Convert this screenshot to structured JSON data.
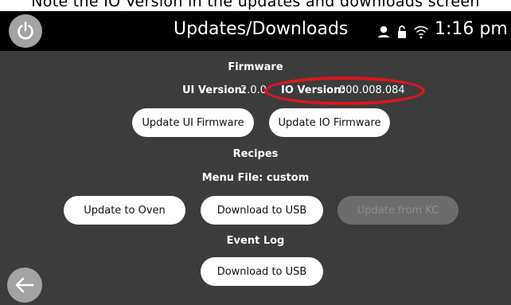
{
  "top_strip": {
    "text": "Note the IO Version in the updates and downloads screen"
  },
  "header": {
    "title": "Updates/Downloads",
    "clock": "1:16 pm",
    "icons": [
      "power-icon",
      "user-icon",
      "lock-icon",
      "wifi-icon"
    ]
  },
  "firmware": {
    "heading": "Firmware",
    "ui_version_label": "UI Version:",
    "ui_version_value": "2.0.0",
    "io_version_label": "IO Version:",
    "io_version_value": "000.008.084",
    "update_ui_label": "Update UI Firmware",
    "update_io_label": "Update IO Firmware"
  },
  "recipes": {
    "heading": "Recipes",
    "menu_file": "Menu File: custom",
    "update_oven_label": "Update to Oven",
    "download_usb_label": "Download to USB",
    "update_kc_label": "Update from KC"
  },
  "event_log": {
    "heading": "Event Log",
    "download_usb_label": "Download to USB"
  },
  "colors": {
    "background": "#3c3c3c",
    "header": "#000000",
    "button": "#ffffff",
    "button_disabled": "#6c6c6c",
    "highlight": "#e0141e",
    "round_button": "#a3a3a3"
  }
}
